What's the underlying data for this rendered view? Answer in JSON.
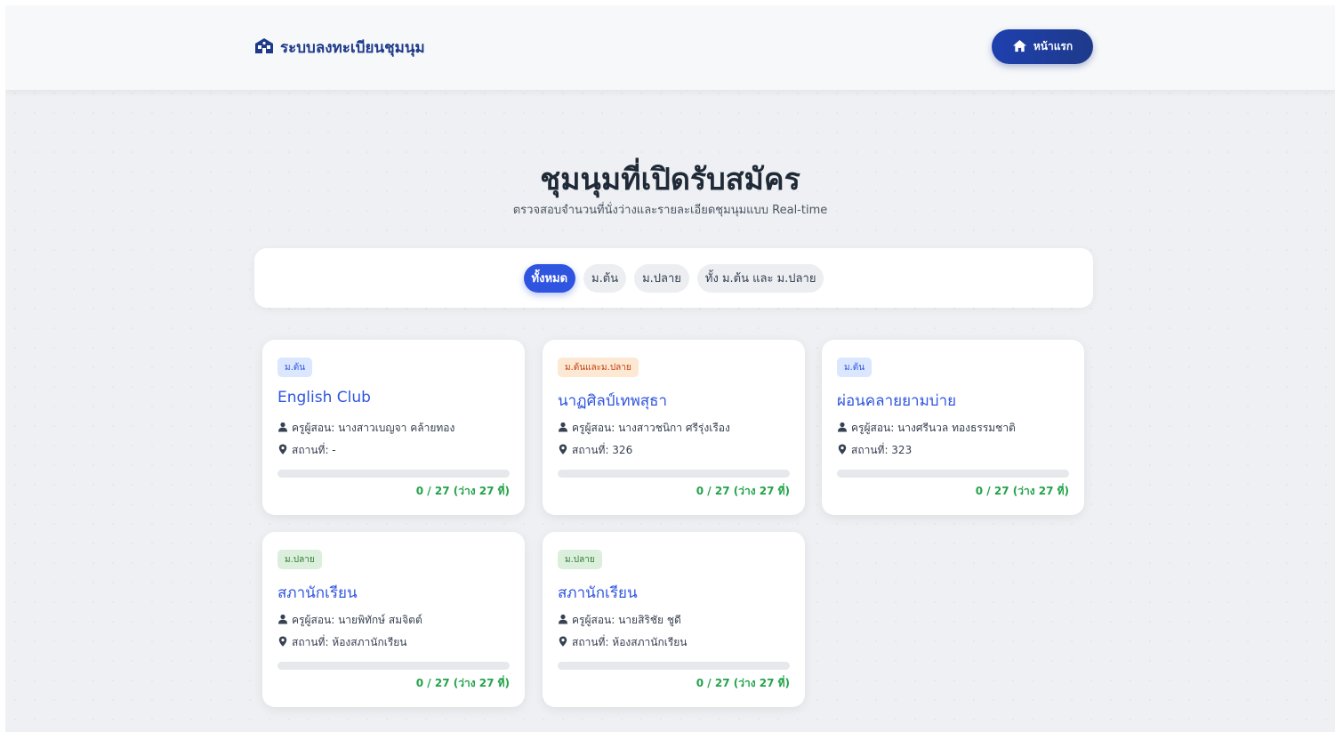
{
  "nav": {
    "brand": "ระบบลงทะเบียนชุมนุม",
    "home_label": "หน้าแรก"
  },
  "hero": {
    "title": "ชุมนุมที่เปิดรับสมัคร",
    "subtitle": "ตรวจสอบจำนวนที่นั่งว่างและรายละเอียดชุมนุมแบบ Real-time"
  },
  "filters": [
    {
      "label": "ทั้งหมด",
      "active": true
    },
    {
      "label": "ม.ต้น",
      "active": false
    },
    {
      "label": "ม.ปลาย",
      "active": false
    },
    {
      "label": "ทั้ง ม.ต้น และ ม.ปลาย",
      "active": false
    }
  ],
  "clubs": [
    {
      "level": "ม.ต้น",
      "title": "English Club",
      "teacher": "ครูผู้สอน: นางสาวเบญจา คล้ายทอง",
      "place": "สถานที่: -",
      "enrolled": 0,
      "capacity": 27,
      "seats_text": "0 / 27 (ว่าง 27 ที่)"
    },
    {
      "level": "ม.ต้นและม.ปลาย",
      "title": "นาฏศิลป์เทพสุธา",
      "teacher": "ครูผู้สอน: นางสาวชนิกา ศรีรุ่งเรือง",
      "place": "สถานที่: 326",
      "enrolled": 0,
      "capacity": 27,
      "seats_text": "0 / 27 (ว่าง 27 ที่)"
    },
    {
      "level": "ม.ต้น",
      "title": "ผ่อนคลายยามบ่าย",
      "teacher": "ครูผู้สอน: นางศรีนวล ทองธรรมชาติ",
      "place": "สถานที่: 323",
      "enrolled": 0,
      "capacity": 27,
      "seats_text": "0 / 27 (ว่าง 27 ที่)"
    },
    {
      "level": "ม.ปลาย",
      "title": "สภานักเรียน",
      "teacher": "ครูผู้สอน: นายพิทักษ์ สมจิตต์",
      "place": "สถานที่: ห้องสภานักเรียน",
      "enrolled": 0,
      "capacity": 27,
      "seats_text": "0 / 27 (ว่าง 27 ที่)"
    },
    {
      "level": "ม.ปลาย",
      "title": "สภานักเรียน",
      "teacher": "ครูผู้สอน: นายสิริชัย ชูดี",
      "place": "สถานที่: ห้องสภานักเรียน",
      "enrolled": 0,
      "capacity": 27,
      "seats_text": "0 / 27 (ว่าง 27 ที่)"
    }
  ],
  "colors": {
    "primary": "#2f55e0",
    "navy": "#1e3a8a",
    "success": "#22a34a"
  },
  "icons": {
    "brand": "school-building-icon",
    "home": "home-icon",
    "teacher": "user-icon",
    "place": "map-pin-icon"
  }
}
